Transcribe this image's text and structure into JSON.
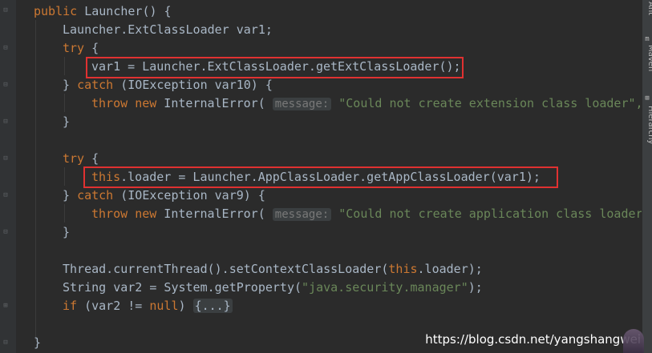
{
  "code": {
    "line1": {
      "kw": "public",
      "text": " Launcher() {"
    },
    "line2": {
      "text": "Launcher.ExtClassLoader var1;"
    },
    "line3": {
      "kw": "try",
      "text": " {"
    },
    "line4": {
      "text": "var1 = Launcher.ExtClassLoader.getExtClassLoader();"
    },
    "line5": {
      "pre": "} ",
      "kw": "catch",
      "text": " (IOException var10) {"
    },
    "line6": {
      "kw1": "throw",
      "kw2": "new",
      "text": " InternalError(",
      "hint": "message:",
      "str": "\"Could not create extension class loader\", "
    },
    "line7": {
      "text": "}"
    },
    "line8": {
      "kw": "try",
      "text": " {"
    },
    "line9": {
      "kw": "this",
      "text": ".loader = Launcher.AppClassLoader.getAppClassLoader(var1);"
    },
    "line10": {
      "pre": "} ",
      "kw": "catch",
      "text": " (IOException var9) {"
    },
    "line11": {
      "kw1": "throw",
      "kw2": "new",
      "text": " InternalError(",
      "hint": "message:",
      "str": "\"Could not create application class loader\" "
    },
    "line12": {
      "text": "}"
    },
    "line13": {
      "pre": "Thread.currentThread().setContextClassLoader(",
      "kw": "this",
      "text": ".loader);"
    },
    "line14": {
      "pre": "String var2 = System.getProperty(",
      "str": "\"java.security.manager\"",
      "text": ");"
    },
    "line15": {
      "kw": "if",
      "pre": " (var2 != ",
      "kw2": "null",
      "text": ") ",
      "fold": "{...}"
    },
    "line16": {
      "text": "}"
    }
  },
  "right_toolbar": {
    "tabs": [
      "Ant",
      "Maven",
      "Hierarchy"
    ],
    "icon_names": [
      "ant-icon",
      "maven-icon",
      "hierarchy-icon"
    ]
  },
  "watermark": "https://blog.csdn.net/yangshangwei",
  "colors": {
    "background": "#2b2b2b",
    "keyword": "#cc7832",
    "string": "#6a8759",
    "plain": "#a9b7c6",
    "highlight_box": "#e03131"
  }
}
